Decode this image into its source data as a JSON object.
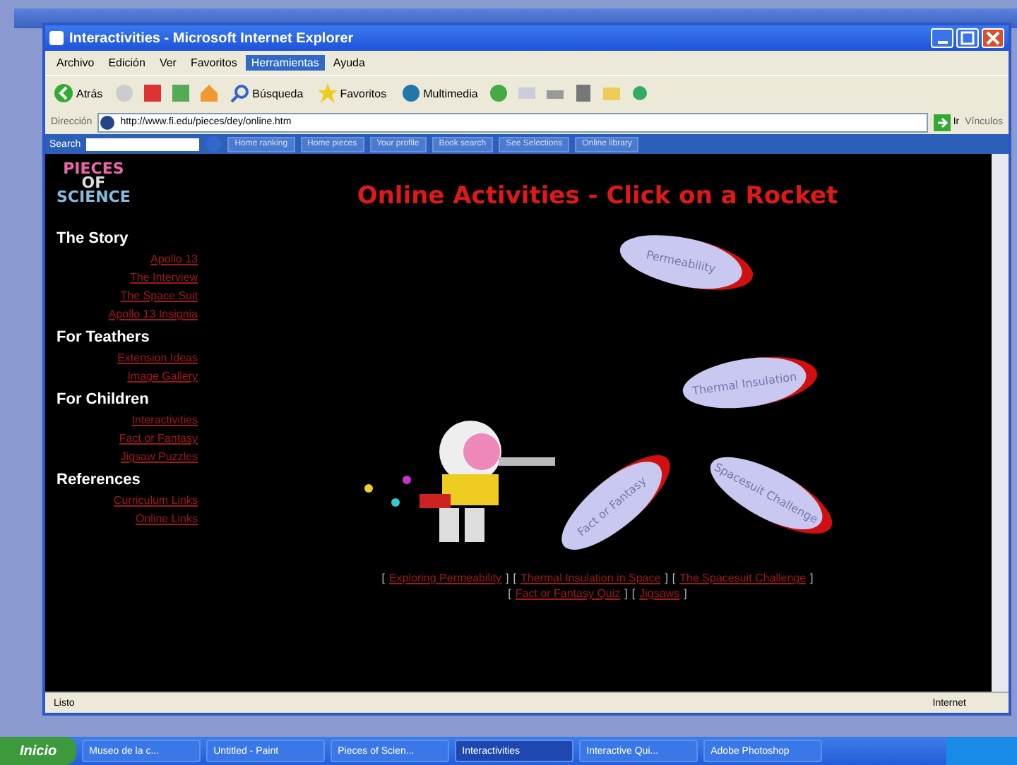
{
  "window": {
    "title": "Interactivities - Microsoft Internet Explorer"
  },
  "menu": [
    {
      "label": "Archivo",
      "selected": false
    },
    {
      "label": "Edición",
      "selected": false
    },
    {
      "label": "Ver",
      "selected": false
    },
    {
      "label": "Favoritos",
      "selected": false
    },
    {
      "label": "Herramientas",
      "selected": true
    },
    {
      "label": "Ayuda",
      "selected": false
    }
  ],
  "toolbar": {
    "back": "Atrás",
    "search": "Búsqueda",
    "favorites": "Favoritos",
    "media": "Multimedia"
  },
  "address": {
    "label": "Dirección",
    "value": "http://www.fi.edu/pieces/dey/online.htm",
    "go": "Ir",
    "links": "Vínculos"
  },
  "search_bar": {
    "label": "Search",
    "buttons": [
      "Home ranking",
      "Home pieces",
      "Your profile",
      "Book search",
      "See Selections",
      "Online library"
    ]
  },
  "sidebar": {
    "logo": [
      "PIECES",
      "OF",
      "SCIENCE"
    ],
    "sections": [
      {
        "title": "The Story",
        "links": [
          "Apollo 13",
          "The Interview",
          "The Space Suit",
          "Apollo 13 Insignia"
        ]
      },
      {
        "title": "For Teathers",
        "links": [
          "Extension Ideas",
          "Image Gallery"
        ]
      },
      {
        "title": "For Children",
        "links": [
          "Interactivities",
          "Fact or Fantasy",
          "Jigsaw Puzzles"
        ]
      },
      {
        "title": "References",
        "links": [
          "Curriculum Links",
          "Online Links"
        ]
      }
    ]
  },
  "main": {
    "heading": "Online Activities - Click on a Rocket",
    "rockets": [
      "Permeability",
      "Thermal Insulation",
      "Fact or Fantasy",
      "Spacesuit Challenge"
    ],
    "brackets": [
      "[",
      "]"
    ],
    "link_lines": [
      [
        "Exploring Permeability",
        "Thermal Insulation in Space",
        "The Spacesuit Challenge"
      ],
      [
        "Fact or Fantasy Quiz",
        "Jigsaws"
      ]
    ]
  },
  "status_bar": {
    "text": "Listo",
    "zone": "Internet"
  },
  "taskbar": {
    "start": "Inicio",
    "items": [
      {
        "label": "Museo de la c...",
        "selected": false
      },
      {
        "label": "Untitled - Paint",
        "selected": false
      },
      {
        "label": "Pieces of Scien...",
        "selected": false
      },
      {
        "label": "Interactivities",
        "selected": true
      },
      {
        "label": "Interactive Qui...",
        "selected": false
      },
      {
        "label": "Adobe Photoshop",
        "selected": false
      }
    ]
  }
}
